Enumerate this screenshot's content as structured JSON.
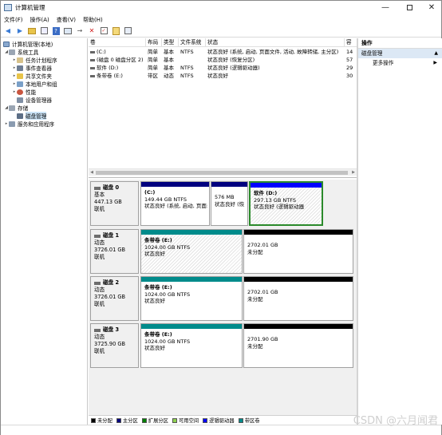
{
  "window": {
    "title": "计算机管理",
    "min_icon": "minimize-icon",
    "max_icon": "maximize-icon",
    "close_icon": "close-icon"
  },
  "menu": [
    "文件(F)",
    "操作(A)",
    "查看(V)",
    "帮助(H)"
  ],
  "toolbar_icons": [
    "back-icon",
    "forward-icon",
    "up-folder-icon",
    "properties-icon",
    "help-icon",
    "console-icon",
    "connect-icon",
    "delete-icon",
    "check-icon",
    "export-icon",
    "refresh-icon"
  ],
  "tree": {
    "root": "计算机管理(本地)",
    "system_tools": "系统工具",
    "task_scheduler": "任务计划程序",
    "event_viewer": "事件查看器",
    "shared_folders": "共享文件夹",
    "local_users": "本地用户和组",
    "performance": "性能",
    "device_manager": "设备管理器",
    "storage": "存储",
    "disk_management": "磁盘管理",
    "services": "服务和应用程序"
  },
  "volume_list": {
    "columns": [
      "卷",
      "布局",
      "类型",
      "文件系统",
      "状态",
      "容"
    ],
    "rows": [
      [
        "(C:)",
        "简单",
        "基本",
        "NTFS",
        "状态良好 (系统, 启动, 页面文件, 活动, 故障转储, 主分区)",
        "14"
      ],
      [
        "(磁盘 0 磁盘分区 2)",
        "简单",
        "基本",
        "",
        "状态良好 (恢复分区)",
        "57"
      ],
      [
        "软件 (D:)",
        "简单",
        "基本",
        "NTFS",
        "状态良好 (逻辑驱动器)",
        "29"
      ],
      [
        "条带卷 (E:)",
        "带区",
        "动态",
        "NTFS",
        "状态良好",
        "30"
      ]
    ]
  },
  "disks": [
    {
      "name": "磁盘 0",
      "kind": "基本",
      "size": "447.13 GB",
      "status": "联机",
      "partitions": [
        {
          "title": "(C:)",
          "size": "149.44 GB NTFS",
          "status": "状态良好 (系统, 启动, 页面:",
          "color": "#00007f"
        },
        {
          "title": "",
          "size": "576 MB",
          "status": "状态良好 (恢",
          "color": "#00007f"
        },
        {
          "title": "软件 (D:)",
          "size": "297.13 GB NTFS",
          "status": "状态良好 (逻辑驱动器",
          "color": "#0000ff"
        }
      ]
    },
    {
      "name": "磁盘 1",
      "kind": "动态",
      "size": "3726.01 GB",
      "status": "联机",
      "partitions": [
        {
          "title": "条带卷 (E:)",
          "size": "1024.00 GB NTFS",
          "status": "状态良好",
          "color": "#008b8b"
        },
        {
          "title": "",
          "size": "2702.01 GB",
          "status": "未分配",
          "color": "#000000"
        }
      ]
    },
    {
      "name": "磁盘 2",
      "kind": "动态",
      "size": "3726.01 GB",
      "status": "联机",
      "partitions": [
        {
          "title": "条带卷 (E:)",
          "size": "1024.00 GB NTFS",
          "status": "状态良好",
          "color": "#008b8b"
        },
        {
          "title": "",
          "size": "2702.01 GB",
          "status": "未分配",
          "color": "#000000"
        }
      ]
    },
    {
      "name": "磁盘 3",
      "kind": "动态",
      "size": "3725.90 GB",
      "status": "联机",
      "partitions": [
        {
          "title": "条带卷 (E:)",
          "size": "1024.00 GB NTFS",
          "status": "状态良好",
          "color": "#008b8b"
        },
        {
          "title": "",
          "size": "2701.90 GB",
          "status": "未分配",
          "color": "#000000"
        }
      ]
    }
  ],
  "legend": [
    {
      "label": "未分配",
      "color": "#000000"
    },
    {
      "label": "主分区",
      "color": "#00007f"
    },
    {
      "label": "扩展分区",
      "color": "#008000"
    },
    {
      "label": "可用空间",
      "color": "#8fd14f"
    },
    {
      "label": "逻辑驱动器",
      "color": "#0000ff"
    },
    {
      "label": "带区卷",
      "color": "#008b8b"
    }
  ],
  "actions": {
    "header": "操作",
    "section": "磁盘管理",
    "more": "更多操作"
  },
  "watermark": "CSDN @六月闻君"
}
